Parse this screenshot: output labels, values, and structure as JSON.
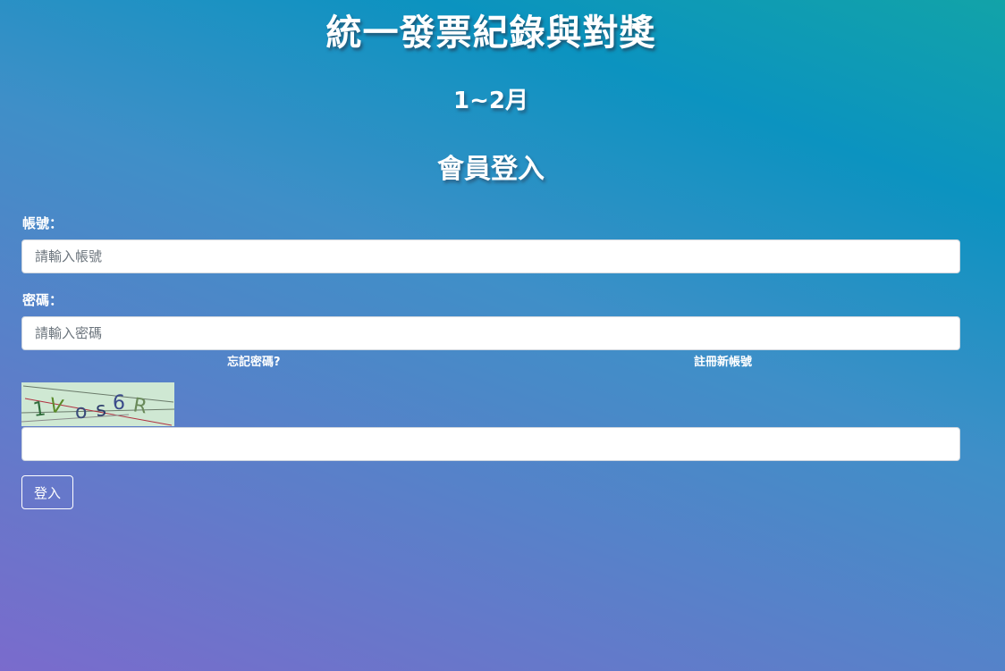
{
  "header": {
    "app_title": "統一發票紀錄與對獎",
    "period": "1~2月",
    "login_heading": "會員登入"
  },
  "form": {
    "account_label": "帳號：",
    "account_placeholder": "請輸入帳號",
    "account_value": "",
    "password_label": "密碼：",
    "password_placeholder": "請輸入密碼",
    "password_value": "",
    "forgot_password_link": "忘記密碼?",
    "register_link": "註冊新帳號",
    "captcha_text": "1V0s6R",
    "captcha_value": "",
    "submit_label": "登入"
  },
  "colors": {
    "background_top_right": "#0b93c0",
    "background_bottom_left": "#7a6bcc",
    "captcha_background": "#cfe8d3"
  }
}
